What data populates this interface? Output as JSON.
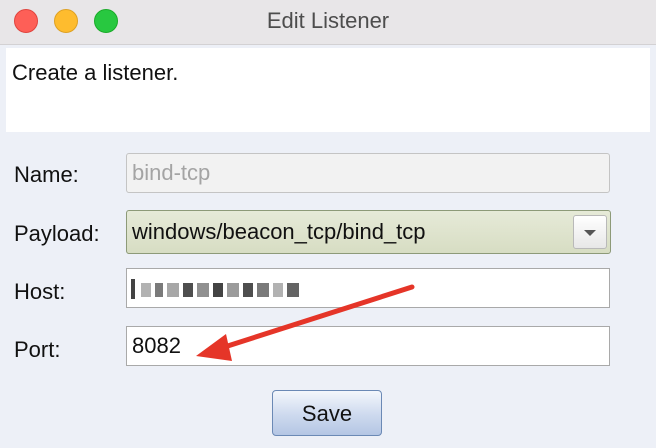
{
  "window": {
    "title": "Edit Listener"
  },
  "description": "Create a listener.",
  "form": {
    "name_label": "Name:",
    "name_value": "bind-tcp",
    "payload_label": "Payload:",
    "payload_value": "windows/beacon_tcp/bind_tcp",
    "host_label": "Host:",
    "host_value": "",
    "port_label": "Port:",
    "port_value": "8082"
  },
  "buttons": {
    "save_label": "Save"
  },
  "annotation": {
    "color": "#e53528"
  },
  "colors": {
    "close": "#fe5f57",
    "minimize": "#febc2e",
    "maximize": "#28c840"
  }
}
